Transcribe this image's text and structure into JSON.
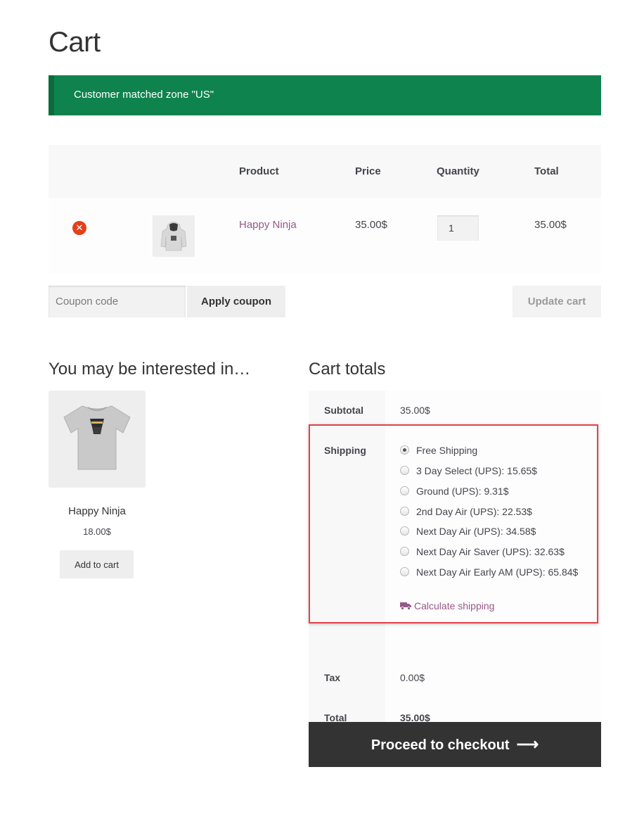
{
  "page": {
    "title": "Cart"
  },
  "notice": {
    "text": "Customer matched zone \"US\""
  },
  "cart_table": {
    "headers": {
      "product": "Product",
      "price": "Price",
      "quantity": "Quantity",
      "total": "Total"
    },
    "rows": [
      {
        "product_name": "Happy Ninja",
        "price": "35.00$",
        "quantity": "1",
        "total": "35.00$"
      }
    ]
  },
  "coupon": {
    "placeholder": "Coupon code",
    "apply_label": "Apply coupon",
    "update_label": "Update cart"
  },
  "cross_sells": {
    "title": "You may be interested in…",
    "products": [
      {
        "name": "Happy Ninja",
        "price": "18.00$",
        "button": "Add to cart"
      }
    ]
  },
  "cart_totals": {
    "title": "Cart totals",
    "subtotal_label": "Subtotal",
    "subtotal_value": "35.00$",
    "shipping_label": "Shipping",
    "shipping_options": [
      {
        "label": "Free Shipping",
        "selected": true
      },
      {
        "label": "3 Day Select (UPS): 15.65$",
        "selected": false
      },
      {
        "label": "Ground (UPS): 9.31$",
        "selected": false
      },
      {
        "label": "2nd Day Air (UPS): 22.53$",
        "selected": false
      },
      {
        "label": "Next Day Air (UPS): 34.58$",
        "selected": false
      },
      {
        "label": "Next Day Air Saver (UPS): 32.63$",
        "selected": false
      },
      {
        "label": "Next Day Air Early AM (UPS): 65.84$",
        "selected": false
      }
    ],
    "calculate_shipping": "Calculate shipping",
    "tax_label": "Tax",
    "tax_value": "0.00$",
    "total_label": "Total",
    "total_value": "35.00$"
  },
  "checkout": {
    "label": "Proceed to checkout",
    "arrow": "⟶"
  },
  "colors": {
    "notice_bg": "#0f834d",
    "link": "#96588a",
    "remove": "#e2401c",
    "highlight": "#e0454c",
    "checkout_bg": "#333333"
  }
}
